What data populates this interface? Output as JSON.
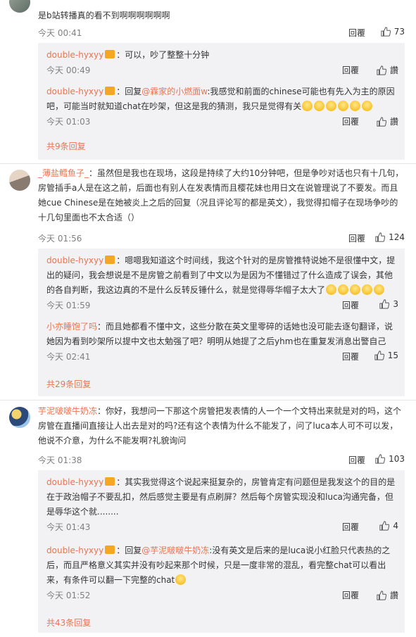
{
  "c1": {
    "text": "是b站转播真的看不到啊啊啊啊啊啊",
    "time": "今天 00:41",
    "reply": "回覆",
    "likes": "73",
    "replies": [
      {
        "user": "double-hyxyy",
        "sep": "：",
        "text": "可以，吵了整整十分钟",
        "time": "今天 00:49",
        "reply": "回覆",
        "like": "讚"
      },
      {
        "user": "double-hyxyy",
        "sep": "：",
        "prefix": "回复",
        "mention": "@霖家的小燃面w",
        "text": ":我感觉和前面的chinese可能也有先入为主的原因吧，可能当时就知道chat在吵架，但这是我的猜测，我只是觉得有关",
        "emoji_count": 6,
        "time": "今天 01:03",
        "reply": "回覆",
        "like": "讚"
      }
    ],
    "more": "共9条回复"
  },
  "c2": {
    "user": "_薄盐鳕鱼子_",
    "sep": "：",
    "text": "虽然但是我也在现场，这段是持续了大约10分钟吧，但是争吵对话也只有十几句，房管插手a人是在这之前，后面也有别人在发表情而且樱花妹也用日文在说管理说了不要发。而且她cue Chinese是在她被炎上之后的回复（况且评论写的都是英文），我觉得扣帽子在现场争吵的十几句里面也不太合适（）",
    "time": "今天 01:56",
    "reply": "回覆",
    "likes": "124",
    "replies": [
      {
        "user": "double-hyxyy",
        "sep": "：",
        "text": "嗯嗯我知道这个时间线，我这个针对的是房管推特说她不是很懂中文，提出的疑问，我会想说是不是房管之前看到了中文以为是因为不懂错过了什么造成了误会，其他的各自判断，我这边真的不是什么反转反锤什么，就是觉得辱华帽子太大了",
        "emoji_count": 5,
        "time": "今天 01:59",
        "reply": "回覆",
        "likes": "3"
      },
      {
        "user": "小亦睡饱了吗",
        "sep": "：",
        "text": "而且她都看不懂中文，这些分散在英文里零碎的话她也没可能去逐句翻译，说她因为看到吵架所以提中文也太勉强了吧？明明从她提了之后yhm也在重复发消息出警自己",
        "time": "今天 02:41",
        "reply": "回覆",
        "likes": "15"
      }
    ],
    "more": "共29条回复"
  },
  "c3": {
    "user": "芋泥啵啵牛奶冻",
    "sep": "：",
    "text": "你好，我想问一下那这个房管把发表情的人一个一个文特出来就是对的吗，这个房管在直播间直接让人出去是对的吗?还有这个表情为什么不能发了，问了luca本人可不可以发，他说不介意，为什么不能发啊?礼貌询问",
    "time": "今天 01:38",
    "reply": "回覆",
    "likes": "103",
    "replies": [
      {
        "user": "double-hyxyy",
        "sep": "：",
        "text": "其实我觉得这个说起来挺复杂的，房管肯定有问题但是我发这个的目的是在于政治帽子不要乱扣，然后感觉主要是有点刷屏？然后每个房管实现没和luca沟通完备，但是辱华这个就........",
        "time": "今天 01:43",
        "reply": "回覆",
        "likes": "4"
      },
      {
        "user": "double-hyxyy",
        "sep": "：",
        "prefix": "回复",
        "mention": "@芋泥啵啵牛奶冻",
        "text": ":没有英文是后来的是luca说小红脸只代表热的之后，而且严格意义其实并没有吵起来那个时候，只是一度非常的混乱，看完整chat可以看出来，有条件可以翻一下完整的chat",
        "emoji_count": 1,
        "time": "今天 01:52",
        "reply": "回覆",
        "like": "讚"
      }
    ],
    "more": "共43条回复"
  }
}
